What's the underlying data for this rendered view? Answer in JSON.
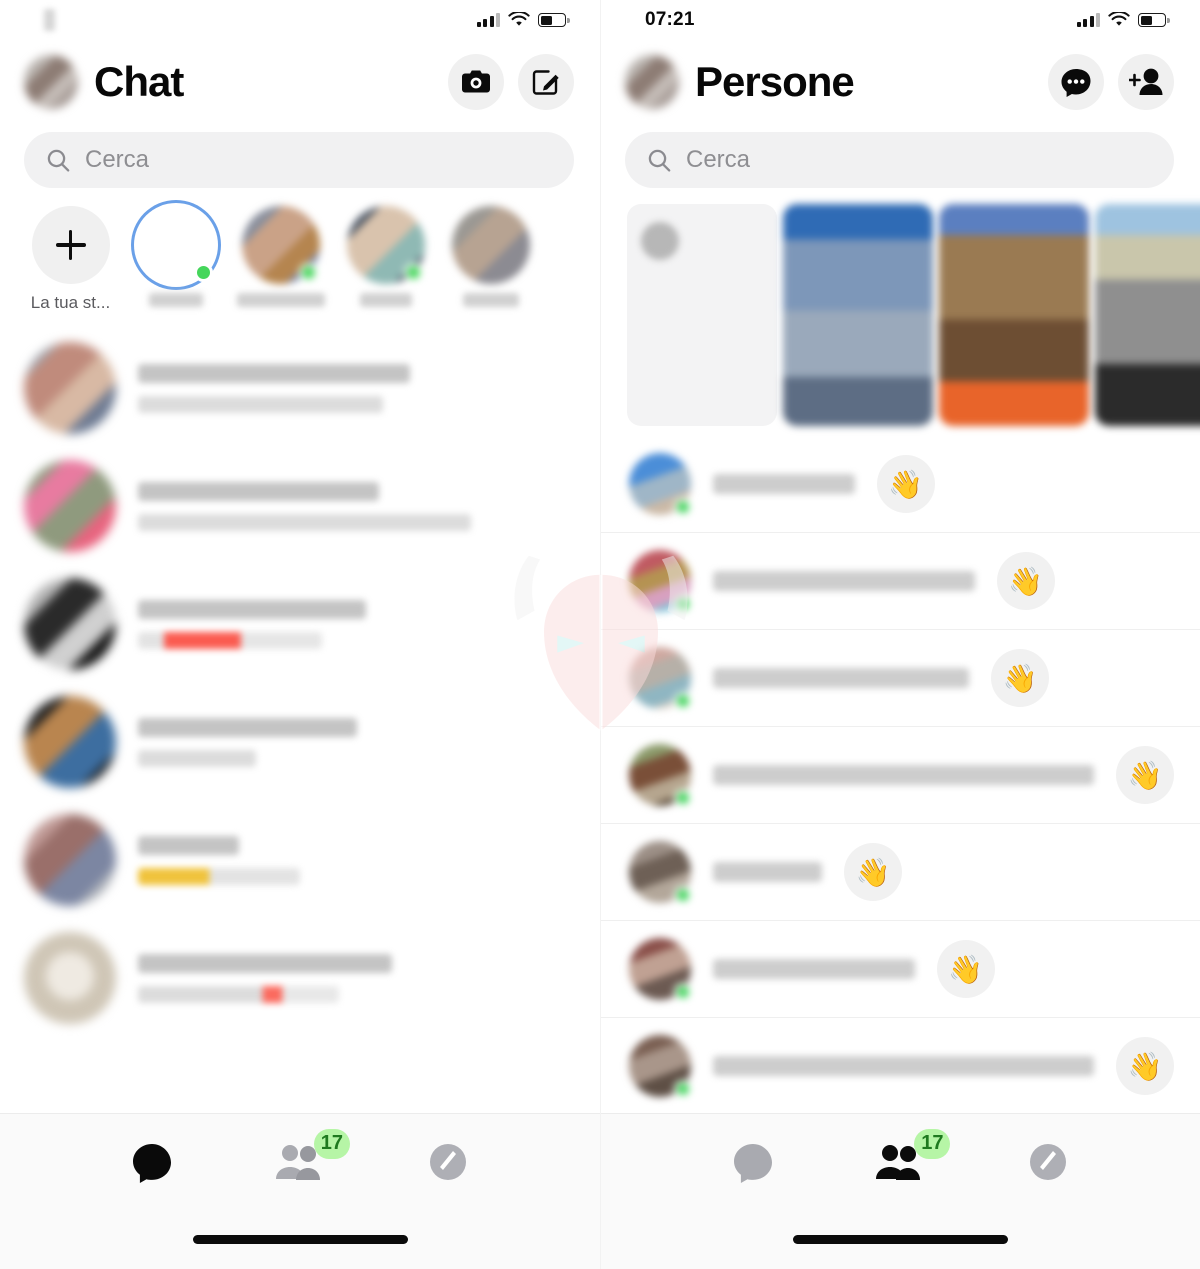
{
  "left": {
    "status_bar": {
      "time": "1",
      "time_blurred": true,
      "signal_icon": "signal-bars-icon",
      "wifi_icon": "wifi-icon",
      "battery_icon": "battery-icon",
      "battery_level_percent": 52
    },
    "header": {
      "title": "Chat",
      "avatar": "profile-avatar",
      "actions": [
        {
          "name": "camera-button",
          "icon": "camera-icon"
        },
        {
          "name": "compose-button",
          "icon": "compose-icon"
        }
      ]
    },
    "search": {
      "placeholder": "Cerca",
      "icon": "search-icon"
    },
    "stories": [
      {
        "label": "La tua st...",
        "type": "add",
        "icon": "plus-icon",
        "online": false,
        "ring": false
      },
      {
        "label": "",
        "type": "photo",
        "online": true,
        "ring": true
      },
      {
        "label": "",
        "type": "photo",
        "online": true,
        "ring": false
      },
      {
        "label": "",
        "type": "photo",
        "online": true,
        "ring": false
      },
      {
        "label": "",
        "type": "photo",
        "online": false,
        "ring": false
      }
    ],
    "chats": [
      {
        "name": "",
        "preview": "",
        "preview_style": "plain",
        "name_width": 62,
        "preview_width": 56
      },
      {
        "name": "",
        "preview": "",
        "preview_style": "plain",
        "name_width": 55,
        "preview_width": 76
      },
      {
        "name": "",
        "preview": "",
        "preview_style": "em-red",
        "name_width": 52,
        "preview_width": 42
      },
      {
        "name": "",
        "preview": "",
        "preview_style": "plain",
        "name_width": 50,
        "preview_width": 27
      },
      {
        "name": "",
        "preview": "",
        "preview_style": "em-yellow",
        "name_width": 23,
        "preview_width": 37
      },
      {
        "name": "",
        "preview": "",
        "preview_style": "em-dot",
        "name_width": 58,
        "preview_width": 46
      }
    ],
    "tabs": [
      {
        "name": "tab-chats",
        "icon": "chat-bubble-icon",
        "active": true,
        "badge": null
      },
      {
        "name": "tab-people",
        "icon": "people-icon",
        "active": false,
        "badge": "17"
      },
      {
        "name": "tab-discover",
        "icon": "compass-icon",
        "active": false,
        "badge": null
      }
    ]
  },
  "right": {
    "status_bar": {
      "time": "07:21",
      "time_blurred": false,
      "signal_icon": "signal-bars-icon",
      "wifi_icon": "wifi-icon",
      "battery_icon": "battery-icon",
      "battery_level_percent": 52
    },
    "header": {
      "title": "Persone",
      "avatar": "profile-avatar",
      "actions": [
        {
          "name": "message-requests-button",
          "icon": "message-dots-icon"
        },
        {
          "name": "add-contact-button",
          "icon": "add-person-icon"
        }
      ]
    },
    "search": {
      "placeholder": "Cerca",
      "icon": "search-icon"
    },
    "story_cards": [
      {
        "type": "create",
        "label": ""
      },
      {
        "type": "photo",
        "variant": "p1"
      },
      {
        "type": "photo",
        "variant": "p2"
      },
      {
        "type": "photo",
        "variant": "p3"
      }
    ],
    "people": [
      {
        "name": "",
        "online": true,
        "action_icon": "wave-hand-icon",
        "name_width": 26
      },
      {
        "name": "",
        "online": true,
        "action_icon": "wave-hand-icon",
        "name_width": 48
      },
      {
        "name": "",
        "online": true,
        "action_icon": "wave-hand-icon",
        "name_width": 47
      },
      {
        "name": "",
        "online": true,
        "action_icon": "wave-hand-icon",
        "name_width": 84
      },
      {
        "name": "",
        "online": true,
        "action_icon": "wave-hand-icon",
        "name_width": 20
      },
      {
        "name": "",
        "online": true,
        "action_icon": "wave-hand-icon",
        "name_width": 37
      },
      {
        "name": "",
        "online": true,
        "action_icon": "wave-hand-icon",
        "name_width": 86
      }
    ],
    "tabs": [
      {
        "name": "tab-chats",
        "icon": "chat-bubble-icon",
        "active": false,
        "badge": null
      },
      {
        "name": "tab-people",
        "icon": "people-icon",
        "active": true,
        "badge": "17"
      },
      {
        "name": "tab-discover",
        "icon": "compass-icon",
        "active": false,
        "badge": null
      }
    ]
  },
  "watermark": {
    "icon": "viking-helmet-watermark",
    "color": "#fbdcdc"
  },
  "colors": {
    "online_green": "#45d65b",
    "badge_green": "#b6f5a6",
    "badge_text": "#1f7a1f",
    "story_ring_blue": "#6aa0e8",
    "surface": "#f1f1f2",
    "text_primary": "#080808",
    "text_muted": "#8e8e92"
  },
  "icons": {
    "wave_hand": "👋"
  }
}
